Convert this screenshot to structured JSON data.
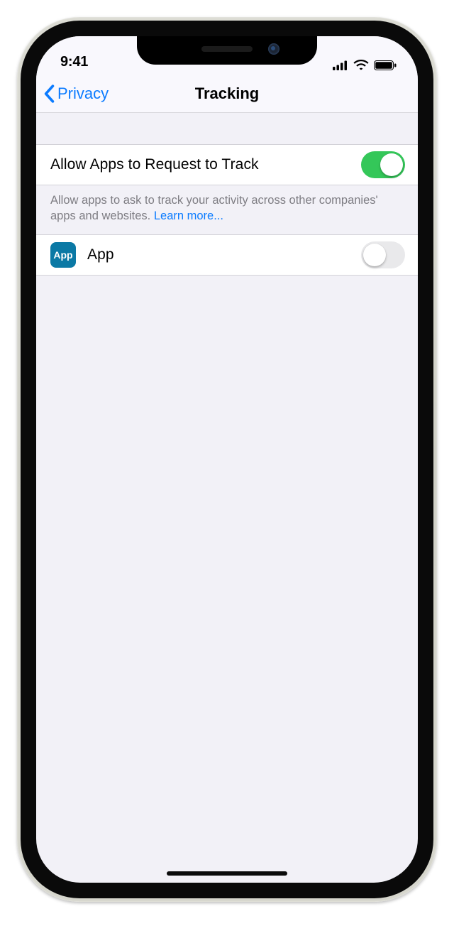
{
  "statusbar": {
    "time": "9:41"
  },
  "nav": {
    "back_label": "Privacy",
    "title": "Tracking"
  },
  "settings": {
    "allow_label": "Allow Apps to Request to Track",
    "allow_on": true,
    "footer_text": "Allow apps to ask to track your activity across other companies' apps and websites. ",
    "footer_link": "Learn more..."
  },
  "apps": [
    {
      "icon_text": "App",
      "name": "App",
      "tracking_on": false
    }
  ],
  "colors": {
    "accent": "#0b7bff",
    "switch_on": "#34c759",
    "app_icon_bg": "#0b79a5"
  }
}
